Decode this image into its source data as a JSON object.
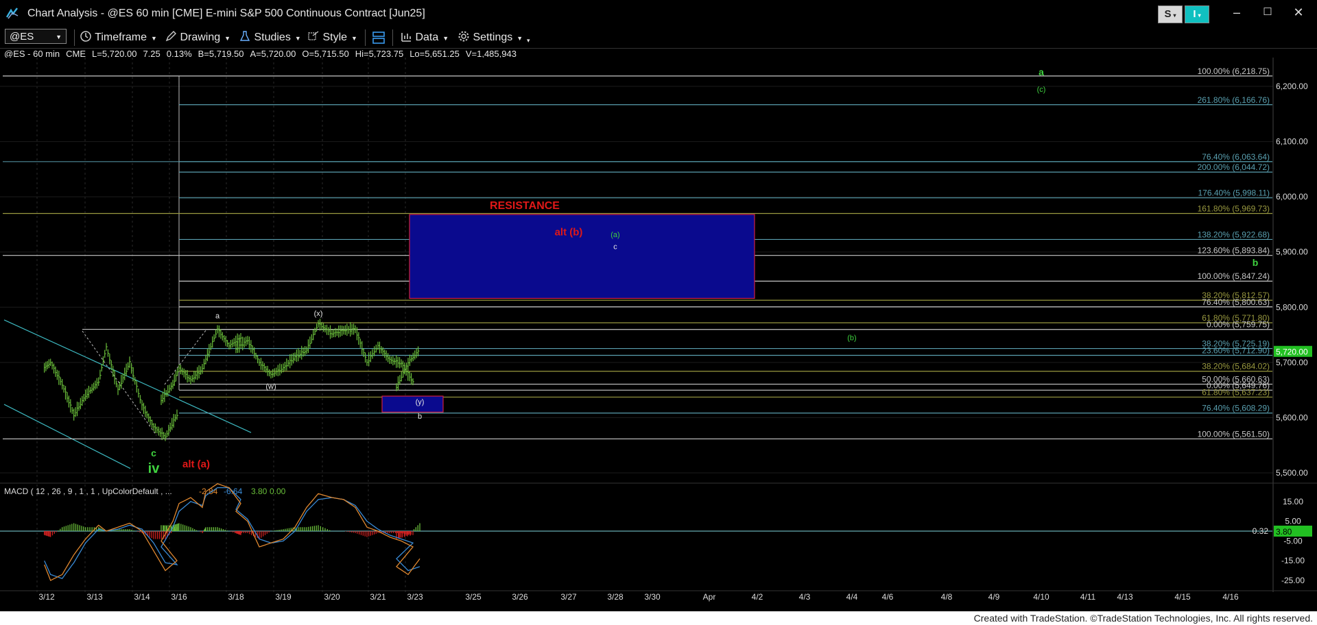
{
  "window": {
    "title": "Chart Analysis - @ES 60 min [CME] E-mini S&P 500 Continuous Contract [Jun25]",
    "s_button": "S",
    "i_button": "I",
    "minimize": "–",
    "maximize": "☐",
    "close": "✕"
  },
  "toolbar": {
    "symbol": "@ES",
    "timeframe": "Timeframe",
    "drawing": "Drawing",
    "studies": "Studies",
    "style": "Style",
    "data": "Data",
    "settings": "Settings"
  },
  "infobar": {
    "symbol": "@ES - 60 min",
    "exchange": "CME",
    "last": "L=5,720.00",
    "change": "7.25",
    "pct": "0.13%",
    "bid": "B=5,719.50",
    "ask": "A=5,720.00",
    "open": "O=5,715.50",
    "high": "Hi=5,723.75",
    "low": "Lo=5,651.25",
    "volume": "V=1,485,943"
  },
  "colors": {
    "bg": "#000000",
    "grid": "#2a2a2a",
    "bar": "#6abf3a",
    "green_label": "#3fd23f",
    "red_label": "#e01818",
    "cyan": "#3db8c0",
    "fib_white": "#c8c8c8",
    "fib_olive": "#9a9a40",
    "fib_teal": "#5aa0b0",
    "resistance_fill": "#0a0a8e",
    "resistance_border": "#d02040",
    "last_price_bg": "#22c022",
    "macd_line": "#e08830",
    "signal_line": "#3a8cd8"
  },
  "footer": "Created with TradeStation. ©TradeStation Technologies, Inc. All rights reserved.",
  "chart_data": {
    "type": "line",
    "title": "@ES 60 min [CME] E-mini S&P 500 Continuous Contract [Jun25]",
    "price_axis": {
      "ylim": [
        5490,
        6245
      ],
      "ticks": [
        "6,200.00",
        "6,100.00",
        "6,000.00",
        "5,900.00",
        "5,800.00",
        "5,700.00",
        "5,600.00",
        "5,500.00"
      ],
      "last_price_label": "5,720.00"
    },
    "x_axis": {
      "ticks": [
        "3/12",
        "3/13",
        "3/14",
        "3/16",
        "3/18",
        "3/19",
        "3/20",
        "3/21",
        "3/23",
        "3/25",
        "3/26",
        "3/27",
        "3/28",
        "3/30",
        "Apr",
        "4/2",
        "4/3",
        "4/4",
        "4/6",
        "4/8",
        "4/9",
        "4/10",
        "4/11",
        "4/13",
        "4/15",
        "4/16"
      ]
    },
    "price_path": [
      [
        "3/11 20:00",
        5690
      ],
      [
        "3/12 02:00",
        5700
      ],
      [
        "3/12 08:00",
        5660
      ],
      [
        "3/12 14:00",
        5605
      ],
      [
        "3/12 20:00",
        5640
      ],
      [
        "3/13 02:00",
        5665
      ],
      [
        "3/13 06:00",
        5728
      ],
      [
        "3/13 12:00",
        5650
      ],
      [
        "3/13 18:00",
        5700
      ],
      [
        "3/14 00:00",
        5622
      ],
      [
        "3/14 06:00",
        5583
      ],
      [
        "3/14 12:00",
        5565
      ],
      [
        "3/14 18:00",
        5605
      ],
      [
        "3/15 00:00",
        5632
      ],
      [
        "3/15 06:00",
        5660
      ],
      [
        "3/16 00:00",
        5690
      ],
      [
        "3/16 06:00",
        5668
      ],
      [
        "3/16 12:00",
        5688
      ],
      [
        "3/17 00:00",
        5705
      ],
      [
        "3/17 06:00",
        5760
      ],
      [
        "3/17 12:00",
        5730
      ],
      [
        "3/17 18:00",
        5745
      ],
      [
        "3/18 00:00",
        5725
      ],
      [
        "3/18 06:00",
        5740
      ],
      [
        "3/18 12:00",
        5700
      ],
      [
        "3/18 18:00",
        5678
      ],
      [
        "3/19 00:00",
        5690
      ],
      [
        "3/19 06:00",
        5710
      ],
      [
        "3/19 12:00",
        5722
      ],
      [
        "3/19 18:00",
        5770
      ],
      [
        "3/20 00:00",
        5752
      ],
      [
        "3/20 06:00",
        5758
      ],
      [
        "3/20 12:00",
        5760
      ],
      [
        "3/20 18:00",
        5700
      ],
      [
        "3/21 00:00",
        5730
      ],
      [
        "3/21 06:00",
        5705
      ],
      [
        "3/21 12:00",
        5698
      ],
      [
        "3/21 18:00",
        5665
      ],
      [
        "3/22 00:00",
        5655
      ],
      [
        "3/22 06:00",
        5700
      ],
      [
        "3/22 12:00",
        5723
      ]
    ],
    "fib_levels": [
      {
        "label": "100.00% (6,218.75)",
        "value": 6218.75,
        "color": "white"
      },
      {
        "label": "261.80% (6,166.76)",
        "value": 6166.76,
        "color": "teal"
      },
      {
        "label": "76.40% (6,063.64)",
        "value": 6063.64,
        "color": "teal"
      },
      {
        "label": "200.00% (6,044.72)",
        "value": 6044.72,
        "color": "teal"
      },
      {
        "label": "176.40% (5,998.11)",
        "value": 5998.11,
        "color": "teal"
      },
      {
        "label": "161.80% (5,969.73)",
        "value": 5969.73,
        "color": "olive"
      },
      {
        "label": "138.20% (5,922.68)",
        "value": 5922.68,
        "color": "teal"
      },
      {
        "label": "123.60% (5,893.84)",
        "value": 5893.84,
        "color": "white"
      },
      {
        "label": "100.00% (5,847.24)",
        "value": 5847.24,
        "color": "white"
      },
      {
        "label": "38.20% (5,812.57)",
        "value": 5812.57,
        "color": "olive"
      },
      {
        "label": "76.40% (5,800.63)",
        "value": 5800.63,
        "color": "white"
      },
      {
        "label": "61.80% (5,771.80)",
        "value": 5771.8,
        "color": "olive"
      },
      {
        "label": "0.00% (5,759.75)",
        "value": 5759.75,
        "color": "white"
      },
      {
        "label": "38.20% (5,725.19)",
        "value": 5725.19,
        "color": "teal"
      },
      {
        "label": "23.60% (5,712.90)",
        "value": 5712.9,
        "color": "teal"
      },
      {
        "label": "38.20% (5,684.02)",
        "value": 5684.02,
        "color": "olive"
      },
      {
        "label": "50.00% (5,660.63)",
        "value": 5660.63,
        "color": "white"
      },
      {
        "label": "0.00% (5,649.76)",
        "value": 5649.76,
        "color": "white"
      },
      {
        "label": "61.80% (5,637.23)",
        "value": 5637.23,
        "color": "olive"
      },
      {
        "label": "76.40% (5,608.29)",
        "value": 5608.29,
        "color": "teal"
      },
      {
        "label": "100.00% (5,561.50)",
        "value": 5561.5,
        "color": "white"
      }
    ],
    "resistance": {
      "label": "RESISTANCE",
      "top": 5968,
      "bottom": 5816,
      "from": "3/22 12:00",
      "to": "4/2 00:00"
    },
    "support_box": {
      "label": "(y)",
      "top": 5639,
      "bottom": 5610
    },
    "wave_labels": [
      {
        "text": "a",
        "date": "3/17 06:00",
        "price": 5780,
        "color": "white"
      },
      {
        "text": "(x)",
        "date": "3/19 18:00",
        "price": 5784,
        "color": "white"
      },
      {
        "text": "(w)",
        "date": "3/18 18:00",
        "price": 5652,
        "color": "white"
      },
      {
        "text": "(y)",
        "date": "3/22 12:00",
        "price": 5624,
        "color": "white"
      },
      {
        "text": "b",
        "date": "3/22 12:00",
        "price": 5598,
        "color": "white"
      },
      {
        "text": "c",
        "date": "3/14 06:00",
        "price": 5530,
        "color": "green"
      },
      {
        "text": "iv",
        "date": "3/14 06:00",
        "price": 5500,
        "color": "green"
      },
      {
        "text": "alt (a)",
        "date": "3/15 18:00",
        "price": 5510,
        "color": "red"
      },
      {
        "text": "alt (b)",
        "date": "3/27 00:00",
        "price": 5930,
        "color": "red"
      },
      {
        "text": "(a)",
        "date": "3/28 00:00",
        "price": 5927,
        "color": "green"
      },
      {
        "text": "c",
        "date": "3/28 00:00",
        "price": 5905,
        "color": "white"
      },
      {
        "text": "(b)",
        "date": "4/4 00:00",
        "price": 5740,
        "color": "green"
      },
      {
        "text": "a",
        "date": "4/10 00:00",
        "price": 6220,
        "color": "green"
      },
      {
        "text": "(c)",
        "date": "4/10 00:00",
        "price": 6190,
        "color": "green"
      },
      {
        "text": "b",
        "date": "4/17 00:00",
        "price": 5875,
        "color": "green"
      }
    ],
    "macd": {
      "label": "MACD ( 12 , 26 , 9 , 1 , 1 , UpColorDefault , ...",
      "macd_value": "-2.84",
      "signal_value": "-6.64",
      "hist_value": "3.80",
      "zero_value": "0.00",
      "ylim": [
        -32,
        22
      ],
      "ticks": [
        "15.00",
        "5.00",
        "-5.00",
        "-15.00",
        "-25.00"
      ],
      "zero_label": "0.32",
      "last_label": "3.80",
      "macd_line": [
        -17,
        -25,
        -22,
        -12,
        -4,
        3,
        0,
        2,
        4,
        0,
        -10,
        -20,
        -15,
        -5,
        5,
        14,
        17,
        12,
        20,
        24,
        22,
        14,
        10,
        5,
        -8,
        -6,
        -4,
        2,
        12,
        19,
        17,
        16,
        12,
        2,
        0,
        -3,
        -5,
        -8,
        -18,
        -22,
        -14
      ],
      "signal_line": [
        -15,
        -22,
        -24,
        -16,
        -6,
        1,
        0,
        1,
        3,
        1,
        -6,
        -16,
        -17,
        -8,
        2,
        10,
        15,
        13,
        18,
        22,
        22,
        16,
        11,
        6,
        -4,
        -6,
        -5,
        0,
        10,
        16,
        17,
        16,
        13,
        5,
        1,
        -2,
        -4,
        -6,
        -14,
        -20,
        -18
      ],
      "histogram": [
        -2,
        -3,
        2,
        4,
        2,
        2,
        0,
        1,
        1,
        -1,
        -4,
        -4,
        2,
        3,
        3,
        4,
        2,
        -1,
        2,
        2,
        0,
        -2,
        -1,
        -1,
        -4,
        0,
        1,
        2,
        2,
        3,
        0,
        0,
        -1,
        -3,
        -1,
        -1,
        -1,
        -2,
        -4,
        -2,
        4
      ]
    }
  }
}
